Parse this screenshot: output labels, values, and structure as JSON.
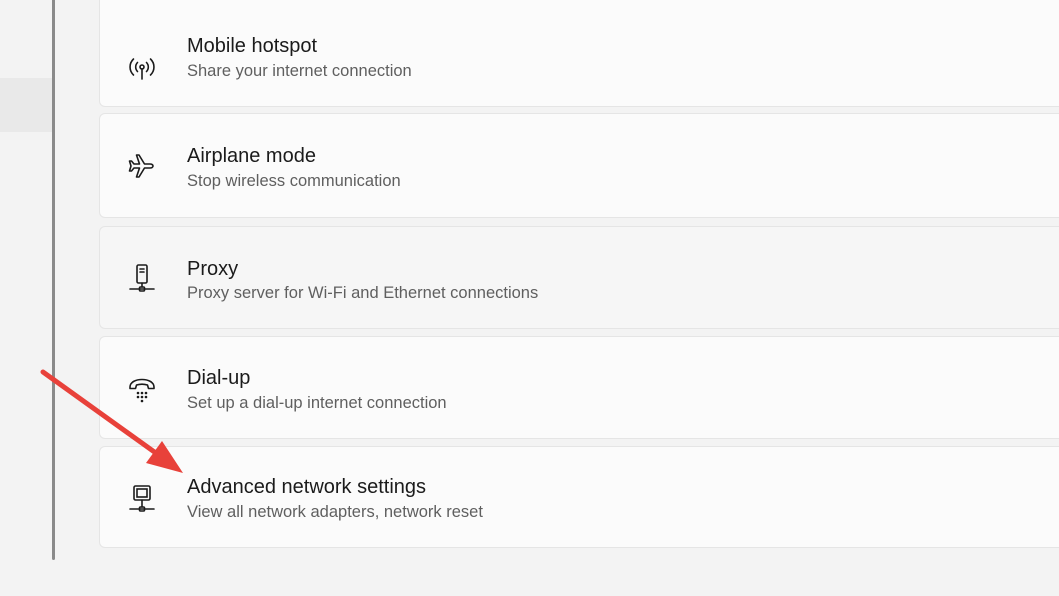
{
  "settings_items": [
    {
      "title": "Mobile hotspot",
      "subtitle": "Share your internet connection",
      "icon": "mobile-hotspot-icon"
    },
    {
      "title": "Airplane mode",
      "subtitle": "Stop wireless communication",
      "icon": "airplane-icon"
    },
    {
      "title": "Proxy",
      "subtitle": "Proxy server for Wi-Fi and Ethernet connections",
      "icon": "proxy-icon"
    },
    {
      "title": "Dial-up",
      "subtitle": "Set up a dial-up internet connection",
      "icon": "dial-up-phone-icon"
    },
    {
      "title": "Advanced network settings",
      "subtitle": "View all network adapters, network reset",
      "icon": "advanced-network-icon"
    }
  ],
  "colors": {
    "background": "#f3f3f3",
    "card": "#fbfbfb",
    "title_text": "#1b1b1b",
    "subtitle_text": "#5f5f5f",
    "annotation_arrow": "#e8413a"
  }
}
